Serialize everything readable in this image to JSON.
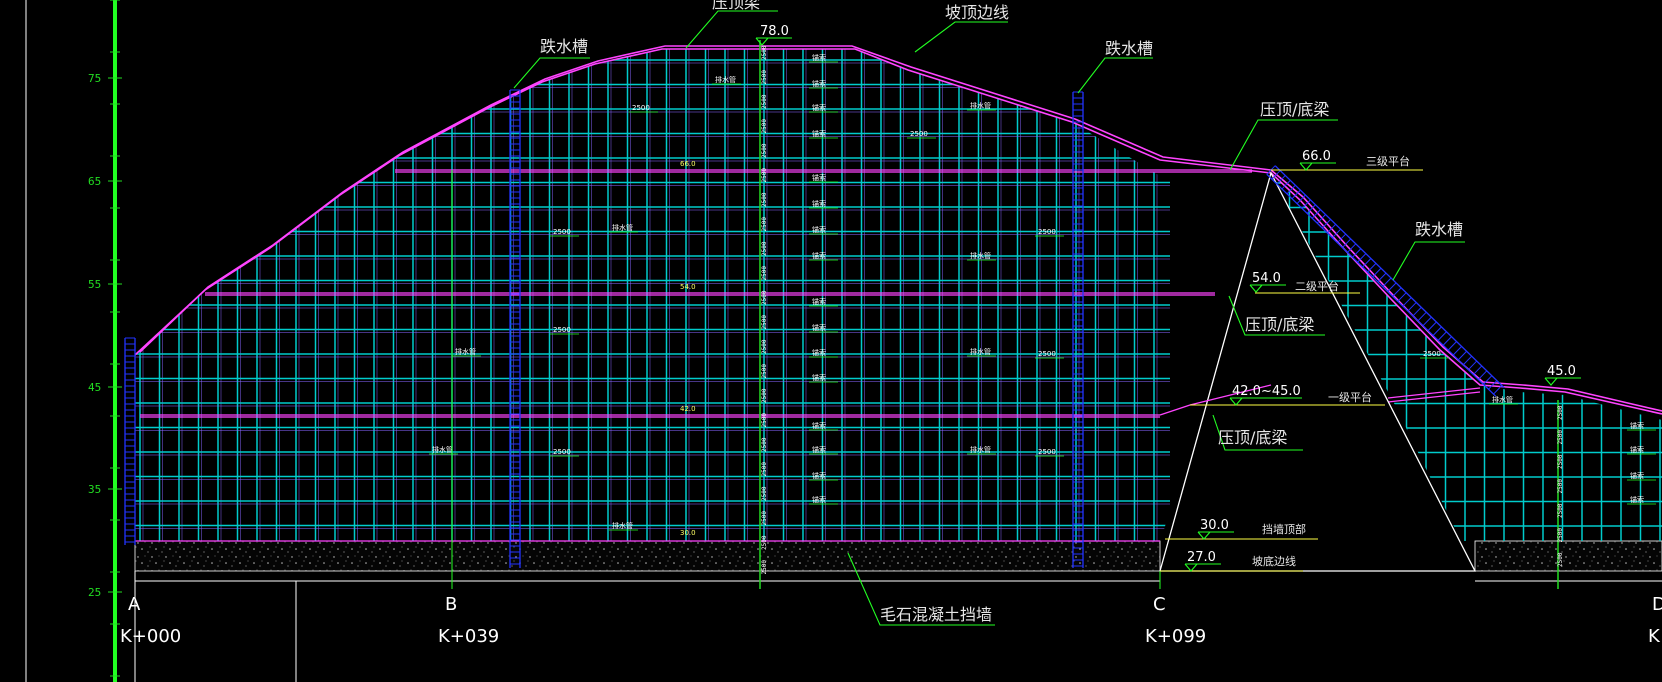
{
  "drawing": {
    "colors": {
      "background": "#000000",
      "grid_beam": "#00cccc",
      "column": "#22dd22",
      "slope_line": "#ff44ff",
      "anchor_stair": "#2233ff",
      "leader": "#22ff22",
      "label": "#ffffff",
      "level_text": "#ffff66"
    },
    "axis": {
      "ticks": [
        {
          "id": "t75",
          "label": "75"
        },
        {
          "id": "t65",
          "label": "65"
        },
        {
          "id": "t55",
          "label": "55"
        },
        {
          "id": "t45",
          "label": "45"
        },
        {
          "id": "t35",
          "label": "35"
        },
        {
          "id": "t25",
          "label": "25"
        }
      ]
    },
    "stations": {
      "A": {
        "letter": "A",
        "chainage": "K+000"
      },
      "B": {
        "letter": "B",
        "chainage": "K+039"
      },
      "C": {
        "letter": "C",
        "chainage": "K+099"
      },
      "D": {
        "letter": "D",
        "chainage": "K"
      }
    },
    "labels": {
      "crown_beam": "压顶梁",
      "slope_top_edge": "坡顶边线",
      "drain_left": "跌水槽",
      "drain_mid": "跌水槽",
      "drain_right": "跌水槽",
      "cap_beam_1": "压顶/底梁",
      "cap_beam_2": "压顶/底梁",
      "cap_beam_3": "压顶/底梁",
      "rubble_wall": "毛石混凝土挡墙",
      "platform_3": "三级平台",
      "platform_2": "二级平台",
      "platform_1": "一级平台",
      "wall_top": "挡墙顶部",
      "slope_bottom_edge": "坡底边线"
    },
    "levels": {
      "top": "78.0",
      "l66": "66.0",
      "l54": "54.0",
      "l42": "42.0~45.0",
      "l45": "45.0",
      "l30": "30.0",
      "l27": "27.0",
      "in66": "66.0",
      "in54": "54.0",
      "in42": "42.0",
      "in30": "30.0"
    },
    "tiny_labels": {
      "anchor": "锚索",
      "drain_pipe": "排水管",
      "spacing": "2500",
      "spacing_v": "2500"
    }
  }
}
